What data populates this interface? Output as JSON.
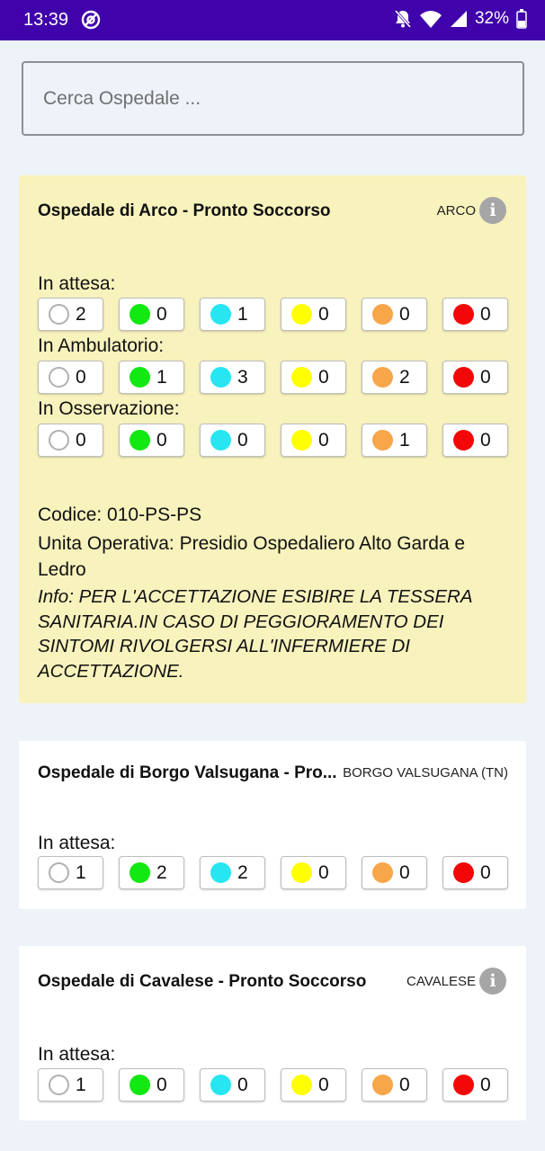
{
  "status_bar": {
    "time": "13:39",
    "battery": "32%"
  },
  "search": {
    "placeholder": "Cerca Ospedale ..."
  },
  "colors": {
    "white": "#ffffff",
    "green": "#12e812",
    "cyan": "#27e6f2",
    "yellow": "#ffff00",
    "orange": "#f7a64a",
    "red": "#f20808"
  },
  "hospitals": [
    {
      "name": "Ospedale di Arco - Pronto Soccorso",
      "city": "ARCO",
      "sections": [
        {
          "label": "In attesa:",
          "values": [
            "2",
            "0",
            "1",
            "0",
            "0",
            "0"
          ]
        },
        {
          "label": "In Ambulatorio:",
          "values": [
            "0",
            "1",
            "3",
            "0",
            "2",
            "0"
          ]
        },
        {
          "label": "In Osservazione:",
          "values": [
            "0",
            "0",
            "0",
            "0",
            "1",
            "0"
          ]
        }
      ],
      "codice": "Codice: 010-PS-PS",
      "unita": "Unita Operativa: Presidio Ospedaliero Alto Garda e Ledro",
      "info": "Info: PER L'ACCETTAZIONE ESIBIRE LA TESSERA SANITARIA.IN CASO DI PEGGIORAMENTO DEI SINTOMI RIVOLGERSI ALL'INFERMIERE DI ACCETTAZIONE."
    },
    {
      "name": "Ospedale di Borgo Valsugana - Pro...",
      "city": "BORGO VALSUGANA (TN)",
      "sections": [
        {
          "label": "In attesa:",
          "values": [
            "1",
            "2",
            "2",
            "0",
            "0",
            "0"
          ]
        }
      ]
    },
    {
      "name": "Ospedale di Cavalese - Pronto Soccorso",
      "city": "CAVALESE",
      "sections": [
        {
          "label": "In attesa:",
          "values": [
            "1",
            "0",
            "0",
            "0",
            "0",
            "0"
          ]
        }
      ]
    }
  ]
}
